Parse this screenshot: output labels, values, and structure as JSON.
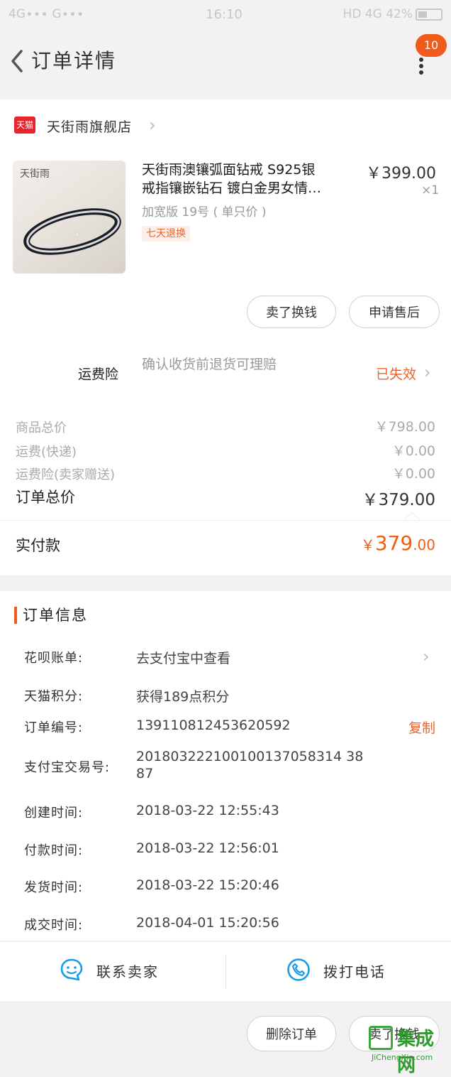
{
  "status_bar": {
    "left": "4G∙∙∙ G∙∙∙",
    "time": "16:10",
    "right": "HD 4G 42%",
    "battery_level": 0.42
  },
  "nav": {
    "title": "订单详情",
    "badge": "10",
    "icons": [
      "back-icon",
      "more-icon"
    ]
  },
  "store": {
    "logo_text": "天猫",
    "name": "天街雨旗舰店"
  },
  "product": {
    "thumb_brand": "天街雨",
    "title_line1": "天街雨澳镶弧面钻戒 S925银",
    "title_line2": "戒指镶嵌钻石 镀白金男女情…",
    "price": "￥399.00",
    "qty": "×1",
    "sku": "加宽版 19号 ( 单只价 )",
    "tag": "七天退换"
  },
  "item_actions": {
    "sell": "卖了换钱",
    "after_sale": "申请售后"
  },
  "insurance": {
    "label": "运费险",
    "desc": "确认收货前退货可理赔",
    "status": "已失效"
  },
  "fees": [
    {
      "label": "商品总价",
      "value": "￥798.00"
    },
    {
      "label": "运费(快递)",
      "value": "￥0.00"
    },
    {
      "label": "运费险(卖家赠送)",
      "value": "￥0.00"
    }
  ],
  "total": {
    "label": "订单总价",
    "value": "￥379.00"
  },
  "paid": {
    "label": "实付款",
    "currency": "￥",
    "integer": "379",
    "decimal": ".00"
  },
  "order_info": {
    "title": "订单信息",
    "rows": [
      {
        "label": "花呗账单:",
        "value": "去支付宝中查看"
      },
      {
        "label": "天猫积分:",
        "value": "获得189点积分"
      },
      {
        "label": "订单编号:",
        "value": "1391108124536205​92"
      },
      {
        "label": "支付宝交易号:",
        "value": "201803222100100137058314 38",
        "value_line2": "87"
      },
      {
        "label": "创建时间:",
        "value": "2018-03-22 12:55:43"
      },
      {
        "label": "付款时间:",
        "value": "2018-03-22 12:56:01"
      },
      {
        "label": "发货时间:",
        "value": "2018-03-22 15:20:46"
      },
      {
        "label": "成交时间:",
        "value": "2018-04-01 15:20:56"
      }
    ],
    "copy": "复制"
  },
  "contact": {
    "seller": "联系卖家",
    "phone": "拨打电话"
  },
  "footer": {
    "delete": "删除订单",
    "sell": "卖了换钱"
  },
  "watermark": {
    "cn": "集成网",
    "en": "JiChengXin.com"
  },
  "colors": {
    "accent": "#f05a1a",
    "price_orange": "#f25d0e",
    "link_orange": "#e8642c",
    "tmall_red": "#e8232a",
    "icon_blue": "#1a9be8"
  }
}
